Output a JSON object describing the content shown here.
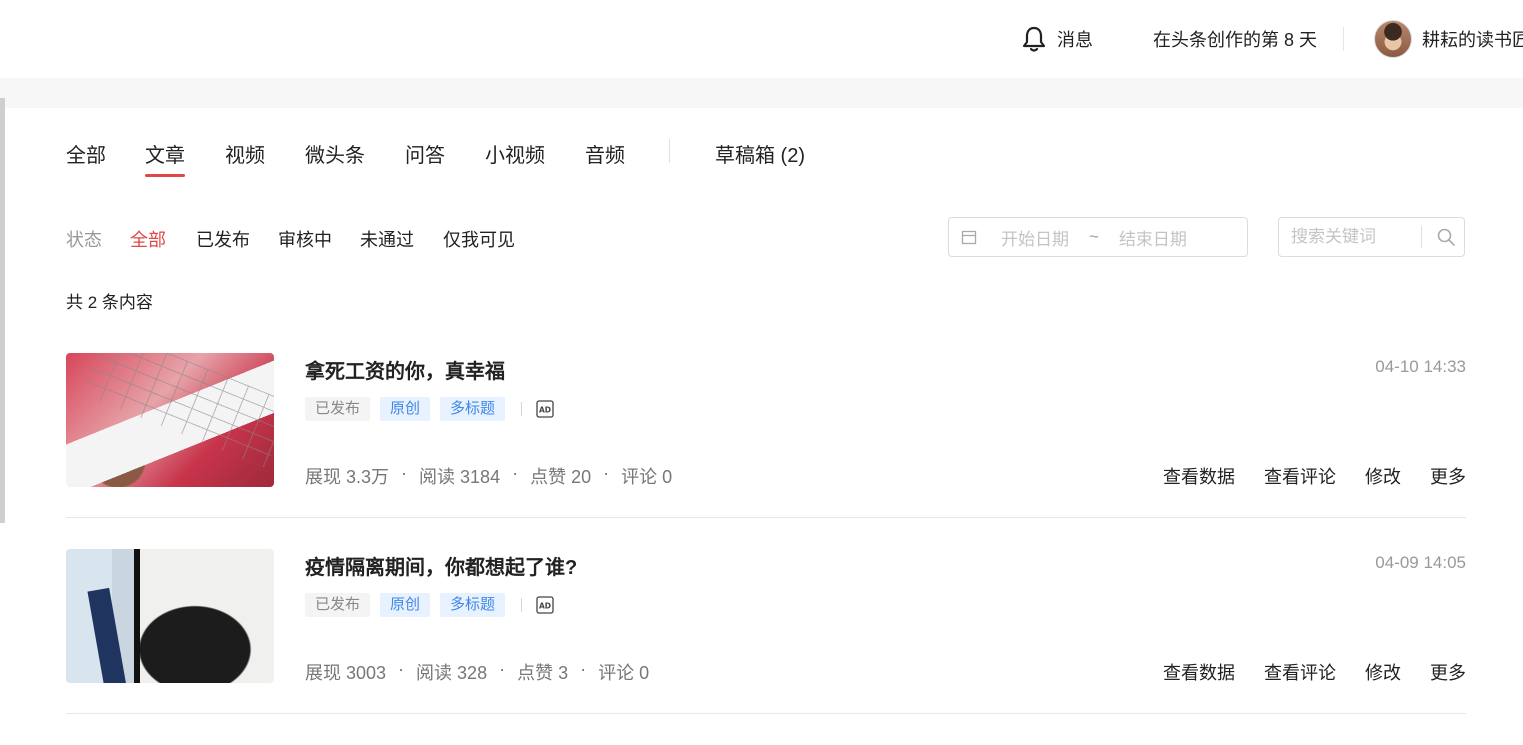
{
  "header": {
    "messages_label": "消息",
    "creation_days": "在头条创作的第 8 天",
    "user_name": "耕耘的读书匠"
  },
  "tabs": [
    {
      "label": "全部"
    },
    {
      "label": "文章",
      "active": true
    },
    {
      "label": "视频"
    },
    {
      "label": "微头条"
    },
    {
      "label": "问答"
    },
    {
      "label": "小视频"
    },
    {
      "label": "音频"
    },
    {
      "label": "草稿箱 (2)"
    }
  ],
  "status_filter": {
    "label": "状态",
    "options": [
      "全部",
      "已发布",
      "审核中",
      "未通过",
      "仅我可见"
    ],
    "selected": "全部"
  },
  "date_range": {
    "start_placeholder": "开始日期",
    "separator": "~",
    "end_placeholder": "结束日期"
  },
  "search": {
    "placeholder": "搜索关键词"
  },
  "content_count": "共 2 条内容",
  "articles": [
    {
      "title": "拿死工资的你，真幸福",
      "date": "04-10 14:33",
      "tags": [
        "已发布",
        "原创",
        "多标题"
      ],
      "stats": [
        "展现 3.3万",
        "阅读 3184",
        "点赞 20",
        "评论 0"
      ],
      "actions": [
        "查看数据",
        "查看评论",
        "修改",
        "更多"
      ]
    },
    {
      "title": "疫情隔离期间，你都想起了谁?",
      "date": "04-09 14:05",
      "tags": [
        "已发布",
        "原创",
        "多标题"
      ],
      "stats": [
        "展现 3003",
        "阅读 328",
        "点赞 3",
        "评论 0"
      ],
      "actions": [
        "查看数据",
        "查看评论",
        "修改",
        "更多"
      ]
    }
  ],
  "colors": {
    "accent": "#e04747",
    "tag_blue": "#3f86e8",
    "tag_blue_bg": "#e8f2ff",
    "muted": "#999999"
  },
  "icons": {
    "bell": "bell-icon",
    "calendar": "calendar-icon",
    "search": "search-icon",
    "ad": "ad-icon"
  }
}
